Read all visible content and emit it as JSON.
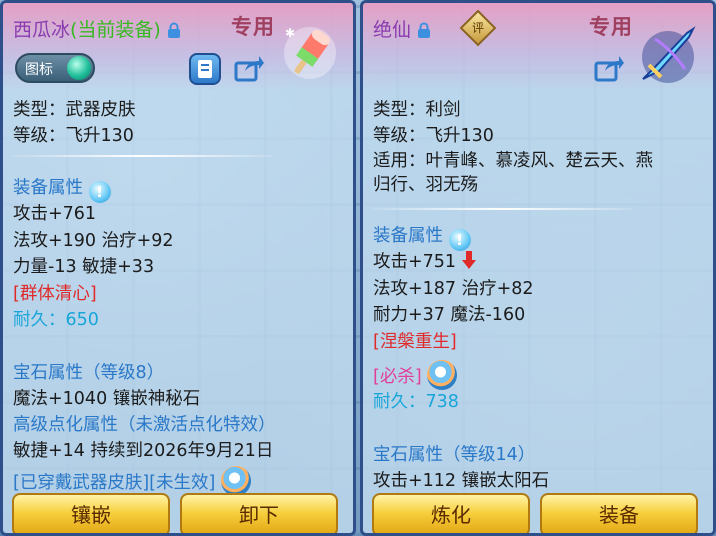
{
  "left": {
    "title_main": "西瓜冰",
    "title_status": "(当前装备)",
    "special_label": "专用",
    "toggle_label": "图标",
    "item_icon": "popsicle-icon",
    "lines": {
      "type": "类型：武器皮肤",
      "level": "等级：飞升130",
      "attr_header": "装备属性",
      "attack": "攻击+761",
      "magic_attack": "法攻+190 治疗+92",
      "str_agi": "力量-13 敏捷+33",
      "skill": "[群体清心]",
      "durability_label": "耐久：",
      "durability_value": "650",
      "gem_header": "宝石属性（等级8）",
      "gem_value": "魔法+1040 镶嵌神秘石",
      "advanced_header": "高级点化属性（未激活点化特效）",
      "advanced_value": "敏捷+14 持续到2026年9月21日",
      "skin_status": "[已穿戴武器皮肤][未生效]"
    },
    "buttons": {
      "inlay": "镶嵌",
      "unequip": "卸下"
    }
  },
  "right": {
    "title_main": "绝仙",
    "special_label": "专用",
    "ping_label": "评",
    "item_icon": "sword-icon",
    "lines": {
      "type": "类型：利剑",
      "level": "等级：飞升130",
      "usable_line1": "适用：叶青峰、慕凌风、楚云天、燕",
      "usable_line2": "归行、羽无殇",
      "attr_header": "装备属性",
      "attack": "攻击+751",
      "magic_attack": "法攻+187 治疗+82",
      "endurance": "耐力+37 魔法-160",
      "skill1": "[涅槃重生]",
      "skill2": "[必杀]",
      "durability_label": "耐久：",
      "durability_value": "738",
      "gem_header": "宝石属性（等级14）",
      "gem_value": "攻击+112 镶嵌太阳石"
    },
    "buttons": {
      "refine": "炼化",
      "equip": "装备"
    }
  },
  "colors": {
    "section_blue": "#2a78c8",
    "skill_red": "#e02a2a",
    "skill_magenta": "#e0409a",
    "durability_cyan": "#18a6d8",
    "current_green": "#38b822",
    "title_purple": "#8a3bb0"
  }
}
